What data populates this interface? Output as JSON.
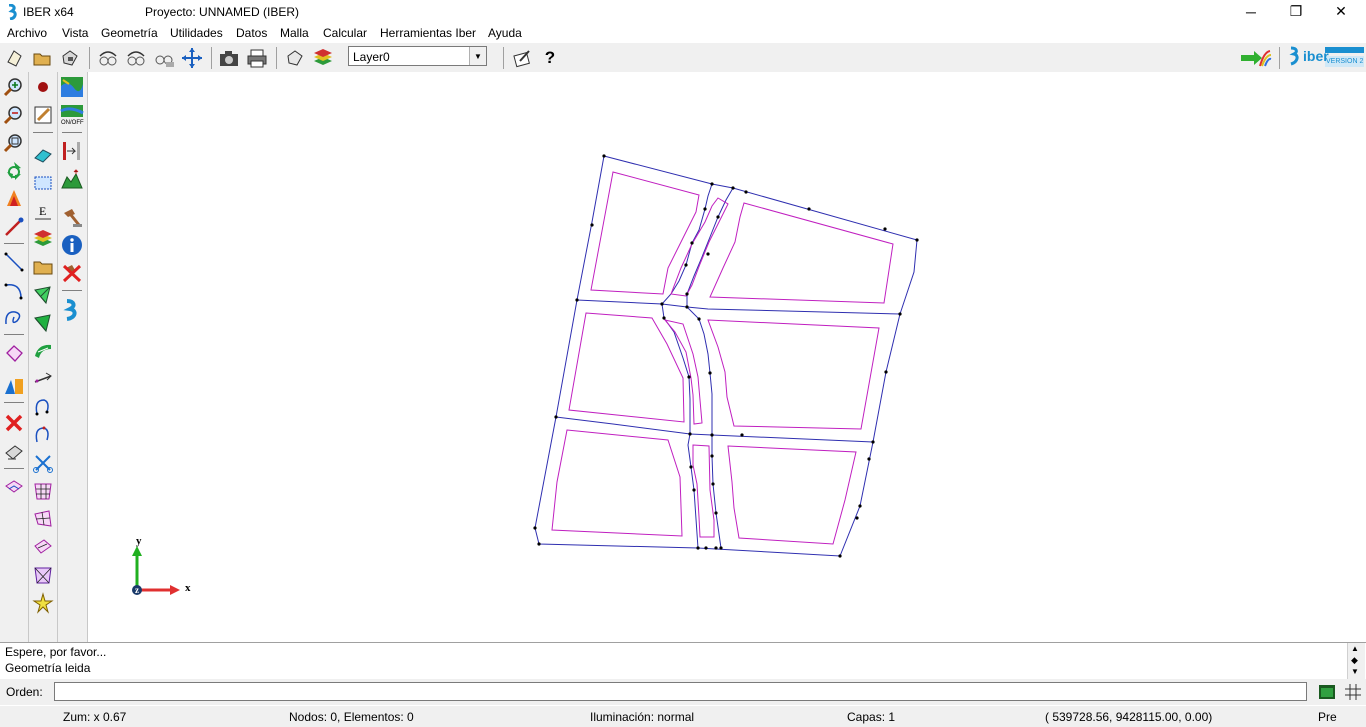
{
  "window": {
    "app_title": "IBER x64",
    "project_title": "Proyecto: UNNAMED (IBER)",
    "minimize_glyph": "─",
    "maximize_glyph": "❐",
    "close_glyph": "✕"
  },
  "menu": [
    "Archivo",
    "Vista",
    "Geometría",
    "Utilidades",
    "Datos",
    "Malla",
    "Calcular",
    "Herramientas Iber",
    "Ayuda"
  ],
  "toolbar": {
    "layer_value": "Layer0",
    "icons": [
      "new-icon",
      "open-icon",
      "save-icon",
      "rotate-trackball-icon",
      "rotate-screen-icon",
      "rotate-object-icon",
      "pan-icon",
      "screenshot-icon",
      "print-icon",
      "render-icon",
      "layers-icon",
      "notes-icon",
      "help-icon"
    ],
    "brand": "iber",
    "brand_version": "VERSION 2"
  },
  "canvas": {
    "axis_y": "y",
    "axis_x": "x",
    "axis_z": "z"
  },
  "console": {
    "line1": "Espere, por favor...",
    "line2": "Geometría leida"
  },
  "command": {
    "label": "Orden:",
    "value": ""
  },
  "status": {
    "zoom": "Zum: x 0.67",
    "nodes": "Nodos: 0, Elementos: 0",
    "lighting": "Iluminación: normal",
    "layers": "Capas: 1",
    "coords": "( 539728.56,  9428115.00,  0.00)",
    "mode": "Pre"
  },
  "colors": {
    "boundary_lines": "#2f2fb0",
    "surface_contours": "#c020c0",
    "points": "#000000",
    "axis_x": "#e03030",
    "axis_y": "#20b020"
  }
}
